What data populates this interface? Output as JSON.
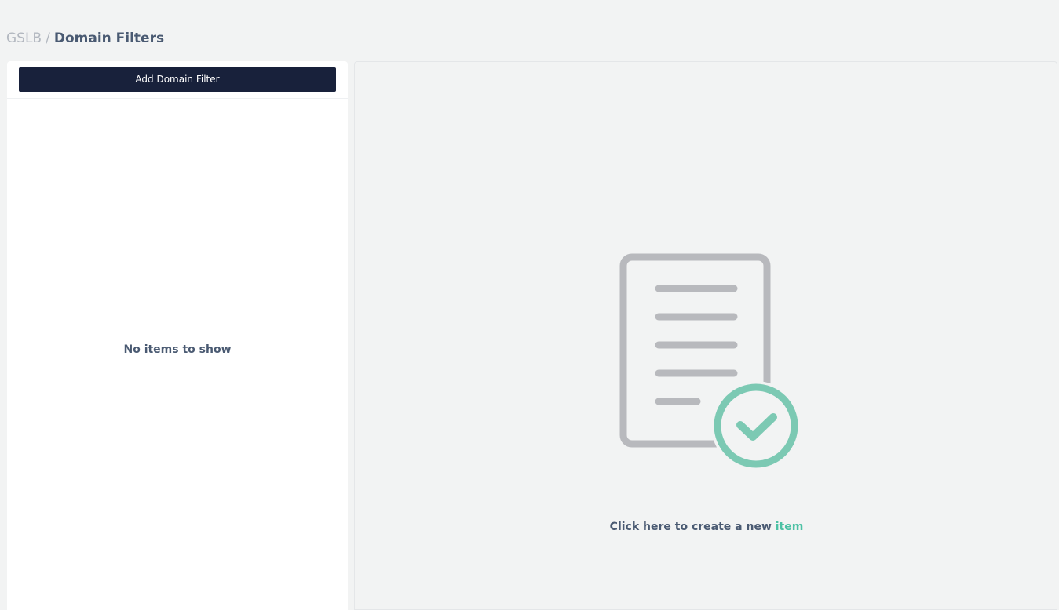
{
  "breadcrumb": {
    "parent": "GSLB",
    "separator": "/",
    "current": "Domain Filters"
  },
  "left_panel": {
    "add_button_label": "Add Domain Filter",
    "empty_message": "No items to show"
  },
  "right_panel": {
    "illustration_icon": "document-check-icon",
    "create_prefix": "Click here to create a new",
    "create_accent": "item"
  },
  "colors": {
    "button_bg": "#18213b",
    "accent": "#4cc1a4",
    "heading_text": "#4a5a72",
    "icon_gray": "#b8b9bd",
    "icon_check": "#7cc9b3"
  }
}
